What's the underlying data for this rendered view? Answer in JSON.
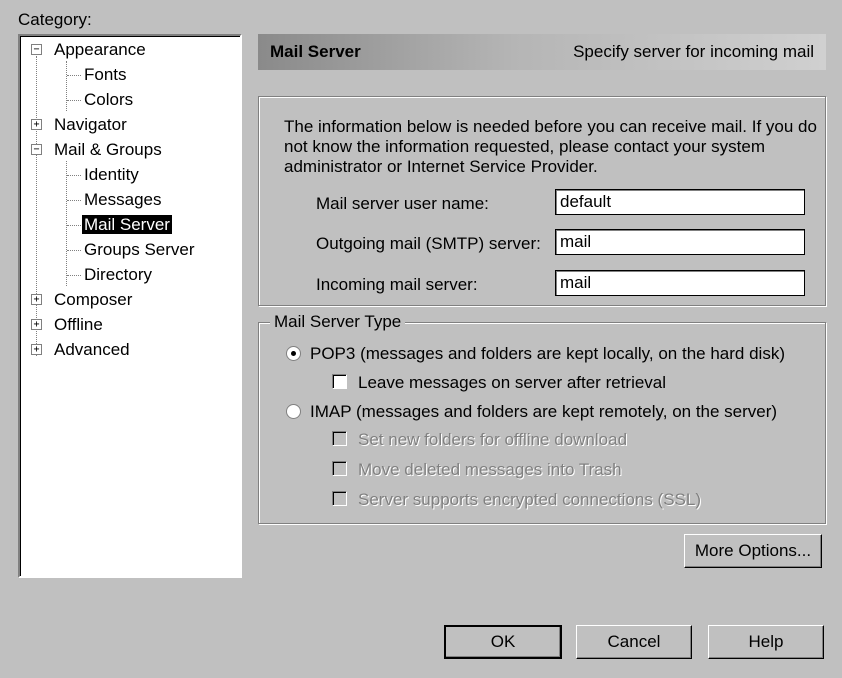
{
  "category": {
    "label": "Category:",
    "items": [
      {
        "label": "Appearance",
        "expander": "−"
      },
      {
        "label": "Fonts"
      },
      {
        "label": "Colors"
      },
      {
        "label": "Navigator",
        "expander": "+"
      },
      {
        "label": "Mail & Groups",
        "expander": "−"
      },
      {
        "label": "Identity"
      },
      {
        "label": "Messages"
      },
      {
        "label": "Mail Server",
        "selected": true
      },
      {
        "label": "Groups Server"
      },
      {
        "label": "Directory"
      },
      {
        "label": "Composer",
        "expander": "+"
      },
      {
        "label": "Offline",
        "expander": "+"
      },
      {
        "label": "Advanced",
        "expander": "+"
      }
    ]
  },
  "header": {
    "title": "Mail Server",
    "subtitle": "Specify server for incoming mail"
  },
  "info": {
    "line1": "The information below is needed before you can receive mail.  If you do",
    "line2": "not know the information requested, please contact your system",
    "line3": "administrator or Internet Service Provider.",
    "fields": [
      {
        "label": "Mail server user name:",
        "value": "default"
      },
      {
        "label": "Outgoing mail (SMTP) server:",
        "value": "mail"
      },
      {
        "label": "Incoming mail server:",
        "value": "mail"
      }
    ]
  },
  "server_type": {
    "legend": "Mail Server Type",
    "pop3": {
      "label": "POP3 (messages and folders are kept locally, on the hard disk)",
      "selected": true
    },
    "leave_on_server": {
      "label": "Leave messages on server after retrieval",
      "checked": false
    },
    "imap": {
      "label": "IMAP (messages and folders are kept remotely, on the server)",
      "selected": false
    },
    "imap_options": [
      "Set new folders for offline download",
      "Move deleted messages into Trash",
      "Server supports encrypted connections (SSL)"
    ]
  },
  "buttons": {
    "more_options": "More Options...",
    "ok": "OK",
    "cancel": "Cancel",
    "help": "Help"
  }
}
